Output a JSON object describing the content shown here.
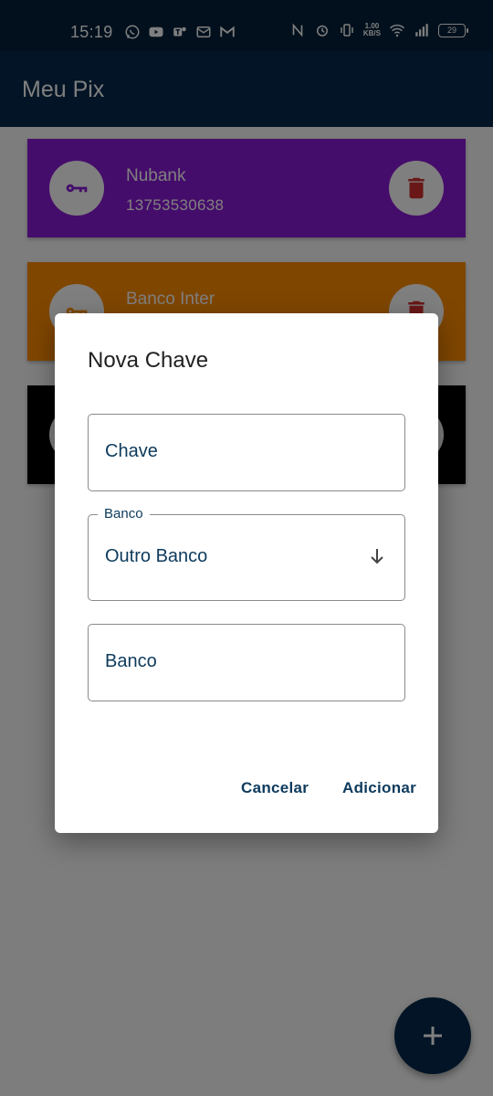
{
  "status_bar": {
    "time": "15:19",
    "net_speed_value": "1.00",
    "net_speed_unit": "KB/S",
    "battery": "29",
    "left_icons": [
      "whatsapp-icon",
      "youtube-icon",
      "teams-icon",
      "outlook-icon",
      "gmail-icon"
    ],
    "right_icons": [
      "nfc-icon",
      "alarm-icon",
      "vibrate-icon",
      "wifi-icon",
      "signal-icon"
    ]
  },
  "app_bar": {
    "title": "Meu Pix"
  },
  "cards": [
    {
      "bank": "Nubank",
      "key": "13753530638",
      "color": "#8b1bd6"
    },
    {
      "bank": "Banco Inter",
      "key": "",
      "color": "#ff8c00"
    },
    {
      "bank": "",
      "key": "",
      "color": "#000000"
    }
  ],
  "dialog": {
    "title": "Nova Chave",
    "key_field": {
      "value": "Chave"
    },
    "bank_select": {
      "label": "Banco",
      "value": "Outro Banco"
    },
    "bank_field": {
      "value": "Banco"
    },
    "cancel_label": "Cancelar",
    "add_label": "Adicionar"
  },
  "colors": {
    "primary": "#04294a",
    "text_accent": "#0d3a5c",
    "delete": "#d32f2f"
  },
  "fab_icon": "plus-icon"
}
